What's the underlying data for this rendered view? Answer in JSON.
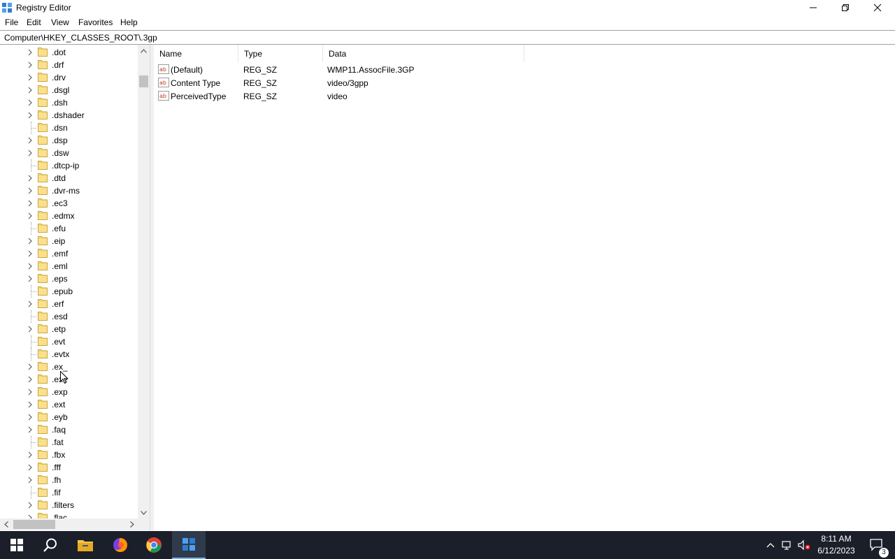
{
  "window": {
    "title": "Registry Editor",
    "minimize_glyph": "—",
    "maximize_glyph": "❐",
    "close_glyph": "✕"
  },
  "menu": [
    "File",
    "Edit",
    "View",
    "Favorites",
    "Help"
  ],
  "address": "Computer\\HKEY_CLASSES_ROOT\\.3gp",
  "tree": {
    "items": [
      {
        "label": ".dot",
        "expandable": true
      },
      {
        "label": ".drf",
        "expandable": true
      },
      {
        "label": ".drv",
        "expandable": true
      },
      {
        "label": ".dsgl",
        "expandable": true
      },
      {
        "label": ".dsh",
        "expandable": true
      },
      {
        "label": ".dshader",
        "expandable": true
      },
      {
        "label": ".dsn",
        "expandable": false
      },
      {
        "label": ".dsp",
        "expandable": true
      },
      {
        "label": ".dsw",
        "expandable": true
      },
      {
        "label": ".dtcp-ip",
        "expandable": false
      },
      {
        "label": ".dtd",
        "expandable": true
      },
      {
        "label": ".dvr-ms",
        "expandable": true
      },
      {
        "label": ".ec3",
        "expandable": true
      },
      {
        "label": ".edmx",
        "expandable": true
      },
      {
        "label": ".efu",
        "expandable": false
      },
      {
        "label": ".eip",
        "expandable": true
      },
      {
        "label": ".emf",
        "expandable": true
      },
      {
        "label": ".eml",
        "expandable": true
      },
      {
        "label": ".eps",
        "expandable": true
      },
      {
        "label": ".epub",
        "expandable": false
      },
      {
        "label": ".erf",
        "expandable": true
      },
      {
        "label": ".esd",
        "expandable": false
      },
      {
        "label": ".etp",
        "expandable": true
      },
      {
        "label": ".evt",
        "expandable": false
      },
      {
        "label": ".evtx",
        "expandable": false
      },
      {
        "label": ".ex_",
        "expandable": true
      },
      {
        "label": ".exe",
        "expandable": true
      },
      {
        "label": ".exp",
        "expandable": true
      },
      {
        "label": ".ext",
        "expandable": true
      },
      {
        "label": ".eyb",
        "expandable": true
      },
      {
        "label": ".faq",
        "expandable": true
      },
      {
        "label": ".fat",
        "expandable": false
      },
      {
        "label": ".fbx",
        "expandable": true
      },
      {
        "label": ".fff",
        "expandable": true
      },
      {
        "label": ".fh",
        "expandable": true
      },
      {
        "label": ".fif",
        "expandable": false
      },
      {
        "label": ".filters",
        "expandable": true
      },
      {
        "label": ".flac",
        "expandable": true
      }
    ]
  },
  "list": {
    "columns": [
      "Name",
      "Type",
      "Data"
    ],
    "rows": [
      {
        "name": "(Default)",
        "type": "REG_SZ",
        "data": "WMP11.AssocFile.3GP"
      },
      {
        "name": "Content Type",
        "type": "REG_SZ",
        "data": "video/3gpp"
      },
      {
        "name": "PerceivedType",
        "type": "REG_SZ",
        "data": "video"
      }
    ]
  },
  "taskbar": {
    "icons": [
      "windows-start-icon",
      "search-icon",
      "file-explorer-icon",
      "firefox-icon",
      "chrome-icon",
      "registry-editor-icon"
    ],
    "time": "8:11 AM",
    "date": "6/12/2023",
    "notification_count": "3"
  },
  "colors": {
    "folder": "#f5d36a",
    "taskbar": "#1b1f2a",
    "accent": "#76b9ed"
  }
}
